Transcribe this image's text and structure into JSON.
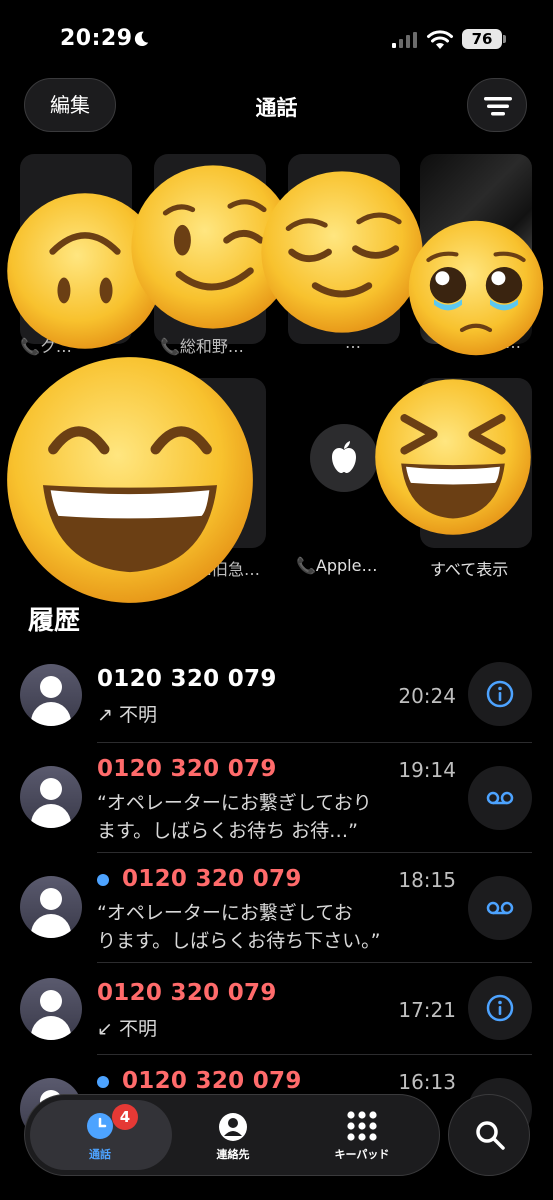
{
  "status_bar": {
    "time": "20:29",
    "battery": "76",
    "icons": [
      "moon-icon",
      "signal-icon",
      "wifi-icon",
      "battery-icon"
    ]
  },
  "nav": {
    "edit_label": "編集",
    "title": "通話",
    "menu_icon": "filter-menu-icon"
  },
  "favorites": {
    "labels": [
      "ク…",
      "総和野…",
      "…",
      "…",
      "…旧急…",
      "Apple…",
      "すべて表示"
    ]
  },
  "history": {
    "title": "履歴",
    "items": [
      {
        "number": "0120 320 079",
        "missed": false,
        "unread": false,
        "detail": "不明",
        "time": "20:24",
        "action": "info-icon"
      },
      {
        "number": "0120 320 079",
        "missed": true,
        "unread": false,
        "detail_line1": "“オペレーターにお繋ぎしており",
        "detail_line2": "ます。しばらくお待ち お待…”",
        "time": "19:14",
        "action": "voicemail-icon"
      },
      {
        "number": "0120 320 079",
        "missed": true,
        "unread": true,
        "detail_line1": "“オペレーターにお繋ぎしてお",
        "detail_line2": "ります。しばらくお待ち下さい。”",
        "time": "18:15",
        "action": "voicemail-icon"
      },
      {
        "number": "0120 320 079",
        "missed": true,
        "unread": false,
        "detail": "不明",
        "time": "17:21",
        "action": "info-icon"
      },
      {
        "number": "0120 320 079",
        "missed": true,
        "unread": true,
        "detail": "",
        "time": "16:13",
        "action": "info-icon"
      }
    ]
  },
  "tabbar": {
    "tabs": [
      {
        "label": "通話",
        "icon": "clock-icon",
        "active": true,
        "badge": "4"
      },
      {
        "label": "連絡先",
        "icon": "person-circle-icon",
        "active": false
      },
      {
        "label": "キーパッド",
        "icon": "keypad-icon",
        "active": false
      }
    ],
    "search_icon": "search-icon"
  },
  "colors": {
    "accent": "#4da3ff",
    "missed": "#ff6b6b",
    "badge": "#e53935",
    "background": "#000000"
  }
}
